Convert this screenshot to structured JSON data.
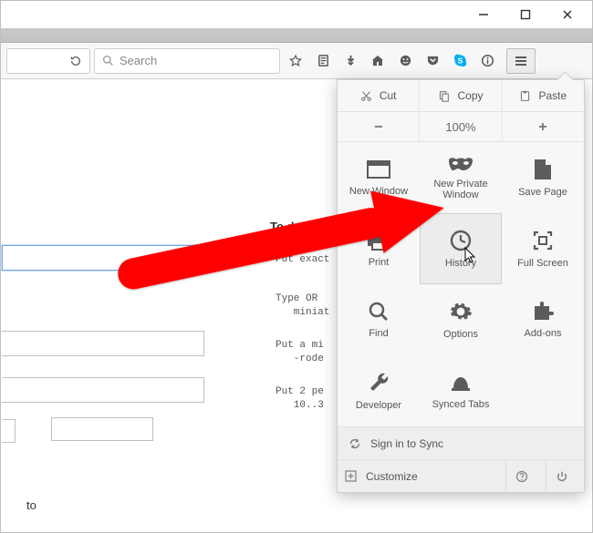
{
  "window": {
    "minimize": "–",
    "maximize": "☐",
    "close": "✕"
  },
  "toolbar": {
    "reload": "↻",
    "search_placeholder": "Search",
    "star": "☆"
  },
  "page": {
    "title": "To do this",
    "hint1": "Put exact",
    "hint2": "Type OR\n   miniat",
    "hint3": "Put a mi\n   -rode",
    "hint4": "Put 2 pe\n   10..3",
    "to_label": "to"
  },
  "menu": {
    "edit": {
      "cut": "Cut",
      "copy": "Copy",
      "paste": "Paste"
    },
    "zoom": {
      "level": "100%"
    },
    "items": [
      {
        "label": "New Window"
      },
      {
        "label": "New Private\nWindow"
      },
      {
        "label": "Save Page"
      },
      {
        "label": "Print"
      },
      {
        "label": "History"
      },
      {
        "label": "Full Screen"
      },
      {
        "label": "Find"
      },
      {
        "label": "Options"
      },
      {
        "label": "Add-ons"
      },
      {
        "label": "Developer"
      },
      {
        "label": "Synced Tabs"
      }
    ],
    "sync": "Sign in to Sync",
    "customize": "Customize"
  }
}
